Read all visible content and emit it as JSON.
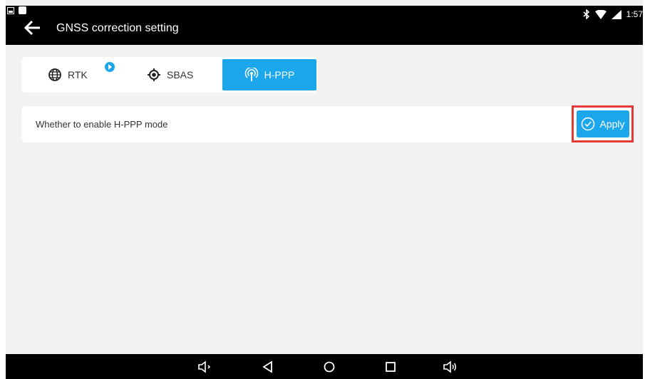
{
  "header": {
    "title": "GNSS correction setting",
    "time": "1:57"
  },
  "tabs": [
    {
      "label": "RTK",
      "icon": "globe-icon"
    },
    {
      "label": "SBAS",
      "icon": "target-icon"
    },
    {
      "label": "H-PPP",
      "icon": "antenna-icon",
      "active": true
    }
  ],
  "option": {
    "label": "Whether to enable H-PPP mode",
    "apply_label": "Apply"
  },
  "colors": {
    "accent": "#1ca7ec",
    "highlight": "#e53935",
    "bar": "#000000",
    "background": "#f2f2f2"
  }
}
